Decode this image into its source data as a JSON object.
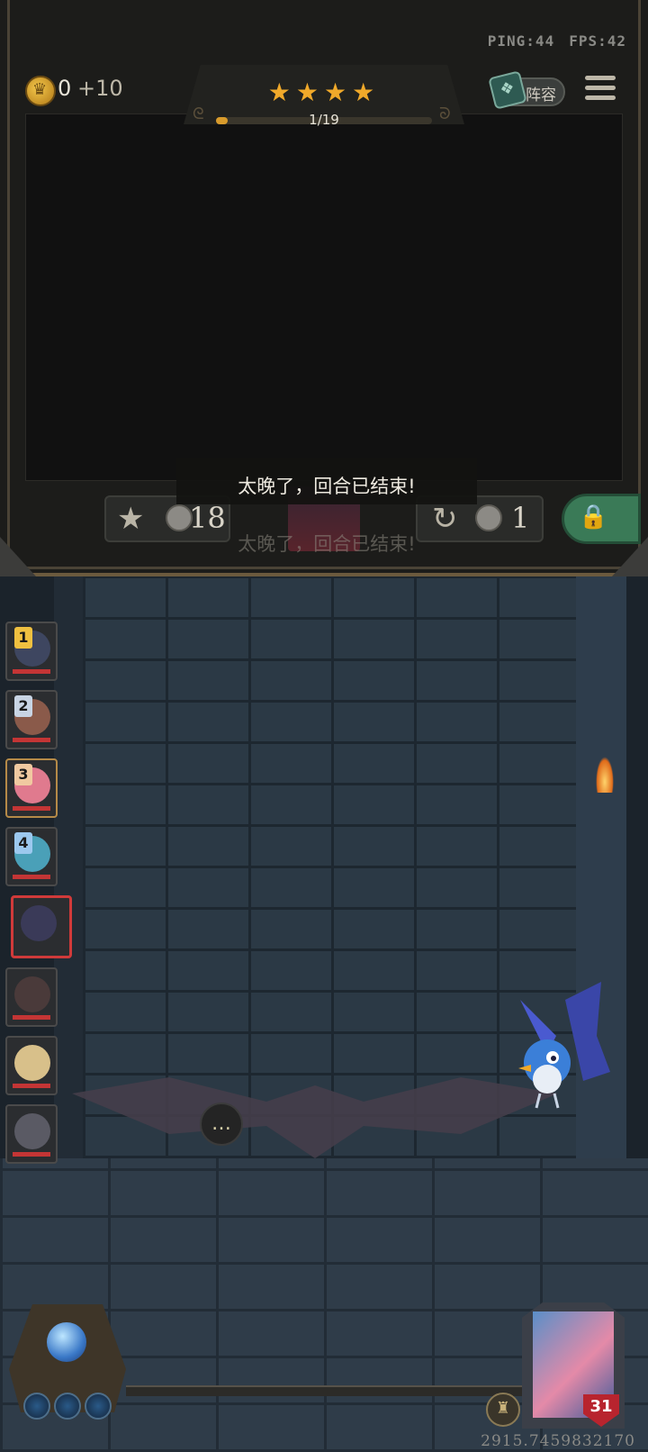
{
  "hud": {
    "ping": "PING:44",
    "fps": "FPS:42"
  },
  "gold": {
    "amount": "0",
    "gain": "+10",
    "icon": "gold-crown-coin-icon"
  },
  "round": {
    "stars": "★★★★",
    "progress_text": "1/19",
    "progress_value": 1,
    "progress_max": 19
  },
  "lineup_button": {
    "label": "阵容",
    "icon": "spellbook-icon"
  },
  "menu_icon": "hamburger-menu-icon",
  "shop": {
    "upgrade_cost": "18",
    "refresh_cost": "1",
    "upgrade_icon": "star-upgrade-icon",
    "refresh_icon": "refresh-icon",
    "lock_icon": "padlock-icon"
  },
  "toast": {
    "message": "太晚了，回合已结束!"
  },
  "heroes": [
    {
      "rank": "1",
      "rank_color": "#f0c040"
    },
    {
      "rank": "2",
      "rank_color": "#c8d4e4"
    },
    {
      "rank": "3",
      "rank_color": "#f0c9a0"
    },
    {
      "rank": "4",
      "rank_color": "#9cc8ee"
    },
    {
      "rank": "",
      "selected": true
    },
    {
      "rank": ""
    },
    {
      "rank": ""
    },
    {
      "rank": ""
    }
  ],
  "player": {
    "health": "31"
  },
  "footer_readout": "2915.7459832170",
  "colors": {
    "accent_gold": "#f0a92a",
    "health_red": "#c43535",
    "lock_green": "#3a7a57"
  }
}
